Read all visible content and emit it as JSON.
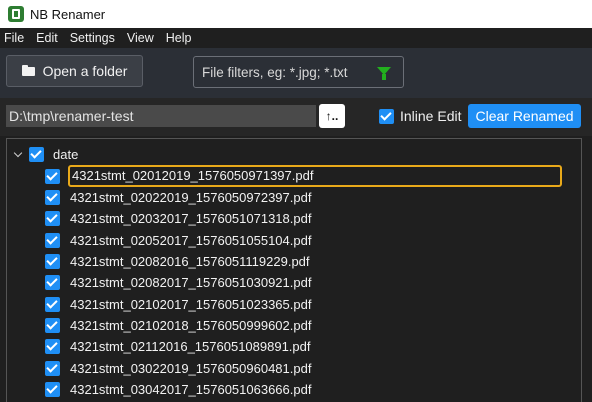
{
  "app": {
    "title": "NB Renamer",
    "icon": "nb-renamer-app-icon"
  },
  "menu": [
    "File",
    "Edit",
    "Settings",
    "View",
    "Help"
  ],
  "toolbar": {
    "open_folder_label": "Open a folder",
    "open_folder_icon": "folder-icon",
    "filter_placeholder": "File filters, eg: *.jpg; *.txt",
    "filter_icon": "funnel-icon",
    "filter_icon_color": "#22b01e"
  },
  "path_row": {
    "path_value": "D:\\tmp\\renamer-test",
    "up_button_label": "↑..",
    "inline_edit_label": "Inline Edit",
    "inline_edit_checked": true,
    "clear_renamed_label": "Clear Renamed"
  },
  "colors": {
    "accent": "#1f8ff5",
    "selection_border": "#e9a91a",
    "background": "#1f1f1f",
    "toolbar": "#2b2f36"
  },
  "tree": {
    "root": {
      "label": "date",
      "checked": true,
      "expanded": true
    },
    "files": [
      {
        "name": "4321stmt_02012019_1576050971397.pdf",
        "checked": true,
        "selected": true
      },
      {
        "name": "4321stmt_02022019_1576050972397.pdf",
        "checked": true
      },
      {
        "name": "4321stmt_02032017_1576051071318.pdf",
        "checked": true
      },
      {
        "name": "4321stmt_02052017_1576051055104.pdf",
        "checked": true
      },
      {
        "name": "4321stmt_02082016_1576051119229.pdf",
        "checked": true
      },
      {
        "name": "4321stmt_02082017_1576051030921.pdf",
        "checked": true
      },
      {
        "name": "4321stmt_02102017_1576051023365.pdf",
        "checked": true
      },
      {
        "name": "4321stmt_02102018_1576050999602.pdf",
        "checked": true
      },
      {
        "name": "4321stmt_02112016_1576051089891.pdf",
        "checked": true
      },
      {
        "name": "4321stmt_03022019_1576050960481.pdf",
        "checked": true
      },
      {
        "name": "4321stmt_03042017_1576051063666.pdf",
        "checked": true
      }
    ]
  }
}
